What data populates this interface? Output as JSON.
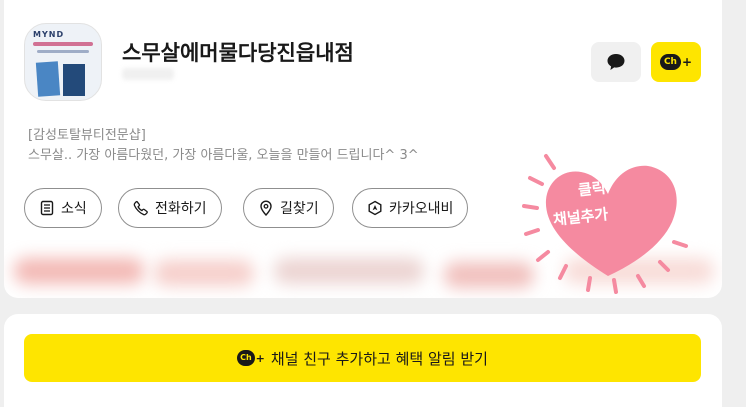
{
  "profile": {
    "name": "스무살에머물다당진읍내점",
    "category": "[감성토탈뷰티전문샵]",
    "description": "스무살.. 가장 아름다웠던, 가장 아름다울, 오늘을 만들어 드립니다^ 3^",
    "avatar_brand": "MYND"
  },
  "actions": {
    "chat_icon": "speech-bubble-icon",
    "add_channel_badge": "Ch",
    "add_channel_plus": "+"
  },
  "menu": [
    {
      "label": "소식",
      "icon": "document-icon"
    },
    {
      "label": "전화하기",
      "icon": "phone-icon"
    },
    {
      "label": "길찾기",
      "icon": "map-pin-icon"
    },
    {
      "label": "카카오내비",
      "icon": "navi-icon"
    }
  ],
  "promo_sticker": {
    "line1": "클릭",
    "line2": "채널추가",
    "color": "#f58aa0"
  },
  "cta": {
    "badge": "Ch",
    "plus": "+",
    "label": "채널 친구 추가하고 혜택 알림 받기"
  },
  "colors": {
    "kakao_yellow": "#fee500",
    "text_dark": "#191919",
    "text_gray": "#8a8a8a"
  }
}
